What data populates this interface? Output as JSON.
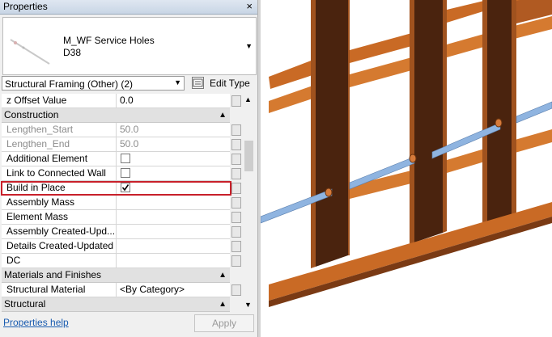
{
  "panel": {
    "title": "Properties",
    "close_glyph": "×",
    "type_selector": {
      "family": "M_WF Service Holes",
      "type": "D38",
      "dropdown_glyph": "▼"
    },
    "category_filter": {
      "selected": "Structural Framing (Other) (2)",
      "arrow_glyph": "▼"
    },
    "edit_type_label": "Edit Type",
    "rows": [
      {
        "kind": "prop",
        "name": "z Offset Value",
        "value": "0.0"
      },
      {
        "kind": "group",
        "name": "Construction",
        "collapse": "▲"
      },
      {
        "kind": "prop",
        "name": "Lengthen_Start",
        "value": "50.0",
        "grey": true
      },
      {
        "kind": "prop",
        "name": "Lengthen_End",
        "value": "50.0",
        "grey": true
      },
      {
        "kind": "prop",
        "name": "Additional Element",
        "checkbox": false
      },
      {
        "kind": "prop",
        "name": "Link to Connected Wall",
        "checkbox": false
      },
      {
        "kind": "prop",
        "name": "Build in Place",
        "checkbox": true,
        "highlighted": true
      },
      {
        "kind": "prop",
        "name": "Assembly Mass",
        "value": ""
      },
      {
        "kind": "prop",
        "name": "Element Mass",
        "value": ""
      },
      {
        "kind": "prop",
        "name": "Assembly Created-Upd...",
        "value": ""
      },
      {
        "kind": "prop",
        "name": "Details Created-Updated",
        "value": ""
      },
      {
        "kind": "prop",
        "name": "DC",
        "value": ""
      },
      {
        "kind": "group",
        "name": "Materials and Finishes",
        "collapse": "▲"
      },
      {
        "kind": "prop",
        "name": "Structural Material",
        "value": "<By Category>"
      },
      {
        "kind": "group",
        "name": "Structural",
        "collapse": "▲"
      }
    ],
    "scroll_up_glyph": "▲",
    "scroll_down_glyph": "▼",
    "help_link": "Properties help",
    "apply_label": "Apply"
  },
  "view": {
    "stud_color": "#a0521e",
    "stud_dark": "#4a230e",
    "hole_pipe_color": "#8fb4e0",
    "highlight_color": "#c8202a"
  }
}
